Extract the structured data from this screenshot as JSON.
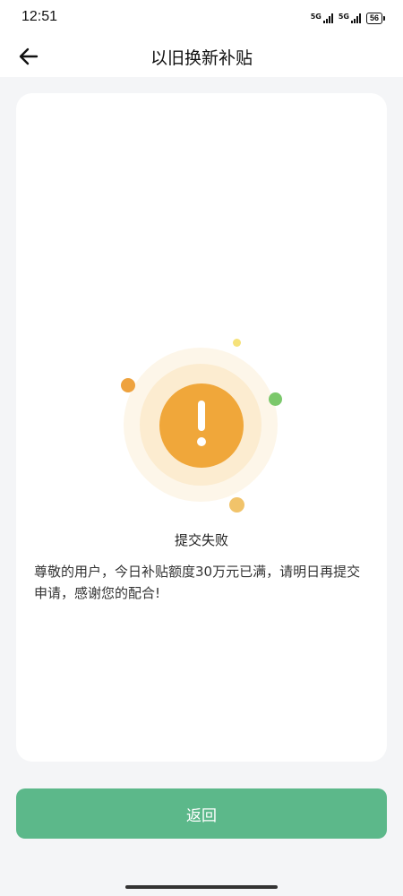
{
  "status_bar": {
    "time": "12:51",
    "network_1": "5G",
    "network_2": "5G",
    "battery": "56"
  },
  "nav": {
    "title": "以旧换新补贴",
    "back_icon": "arrow-left-icon"
  },
  "result": {
    "icon": "exclamation-icon",
    "title": "提交失败",
    "message": "尊敬的用户，今日补贴额度30万元已满，请明日再提交申请，感谢您的配合!"
  },
  "actions": {
    "return_label": "返回"
  },
  "colors": {
    "accent_green": "#5cb88a",
    "alert_orange": "#f0a73a"
  }
}
